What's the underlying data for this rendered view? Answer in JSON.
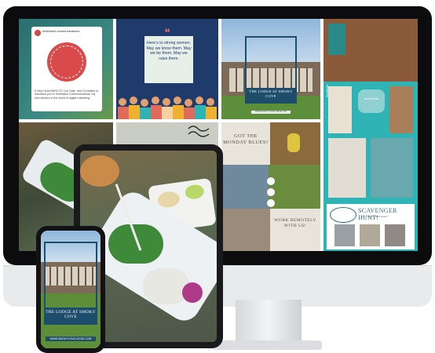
{
  "screen": {
    "instagram_card": {
      "handle": "smithwick.communications",
      "seal_text": "SMITHWICK COMMUNICATIONS",
      "caption": "If Very Hora MARCTO Coe Gate, and I’m thrilled to introduce you to Smithwick Communications, my new venture in the world of digital marketing."
    },
    "quote_post": {
      "quote_mark": "❝",
      "text": "Here’s to strong women. May we know them. May we be them. May we raise them."
    },
    "lodge_post": {
      "title": "THE LODGE AT SMOKY COVE",
      "url": "WWW.SMOKYCOVELODGE.COM"
    },
    "aesthetic_board": {
      "vertical_label": "Aesthetic",
      "heart_text": "smokeyluxe"
    },
    "monday_post": {
      "headline": "GOT THE MONDAY BLUES?",
      "footer": "WORK REMOTELY WITH US!"
    },
    "scavenger_post": {
      "title": "SCAVENGER HUNT!",
      "subtitle": "Can you find all of these?"
    }
  },
  "phone": {
    "title": "THE LODGE AT SMOKY COVE",
    "url": "WWW.SMOKYCOVELODGE.COM"
  },
  "colors": {
    "navy": "#1e4d6b",
    "teal": "#2fb3b5",
    "coral": "#e06b5a"
  }
}
